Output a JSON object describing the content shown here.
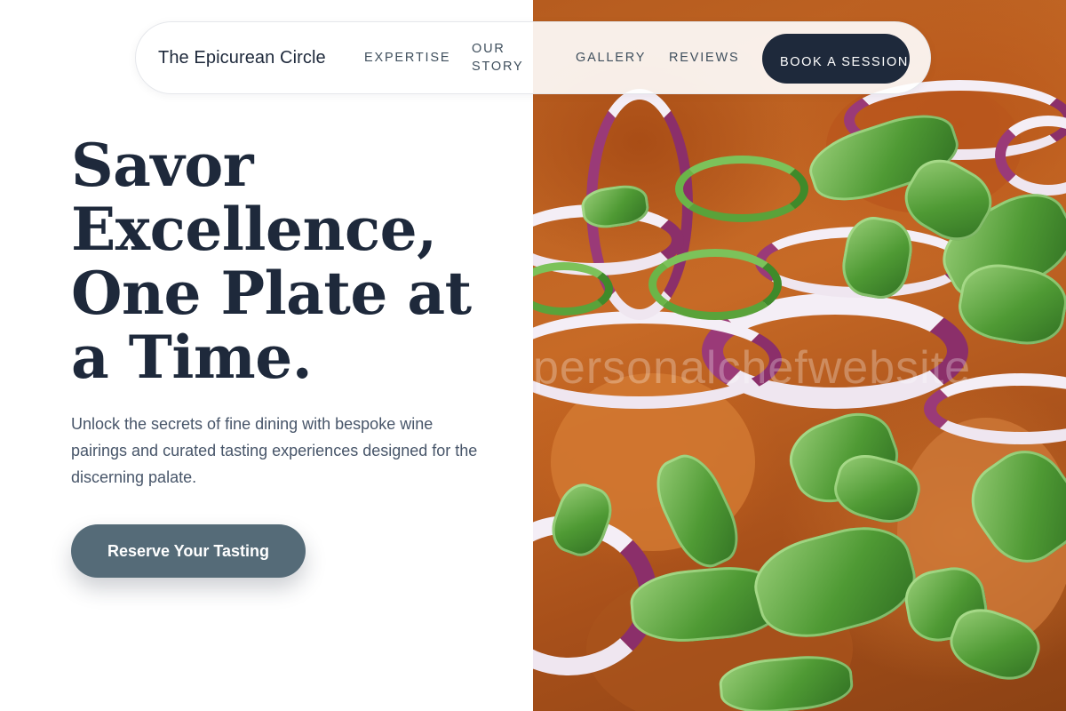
{
  "header": {
    "brand": "The Epicurean Circle",
    "nav": {
      "expertise": "EXPERTISE",
      "our_story": "OUR STORY",
      "gallery": "GALLERY",
      "reviews": "REVIEWS"
    },
    "cta": "BOOK A SESSION"
  },
  "hero": {
    "title": "Savor Excellence, One Plate at a Time.",
    "subtitle": "Unlock the secrets of fine dining with bespoke wine pairings and curated tasting experiences designed for the discerning palate.",
    "cta": "Reserve Your Tasting"
  },
  "image": {
    "subject": "food-closeup-photo",
    "watermark": "personalchefwebsite"
  },
  "colors": {
    "primary_navy": "#1e293b",
    "cta_slate": "#556b78",
    "text_muted": "#475569"
  }
}
